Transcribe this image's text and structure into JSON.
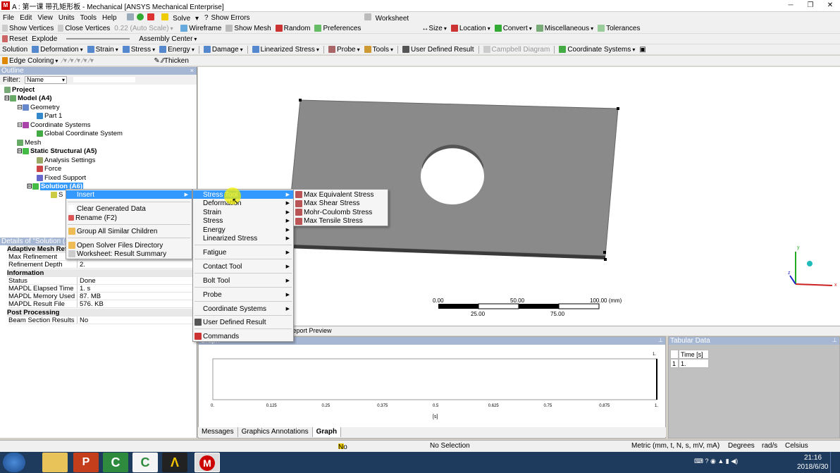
{
  "window": {
    "title": "A : 第一课 带孔矩形板 - Mechanical [ANSYS Mechanical Enterprise]"
  },
  "menubar": [
    "File",
    "Edit",
    "View",
    "Units",
    "Tools",
    "Help"
  ],
  "toolbar1": {
    "solve": "Solve",
    "show_errors": "Show Errors",
    "worksheet": "Worksheet"
  },
  "toolbar2": {
    "show_vertices": "Show Vertices",
    "close_vertices": "Close Vertices",
    "auto_scale": "0.22 (Auto Scale)",
    "wireframe": "Wireframe",
    "show_mesh": "Show Mesh",
    "random": "Random",
    "preferences": "Preferences",
    "size": "Size",
    "location": "Location",
    "convert": "Convert",
    "misc": "Miscellaneous",
    "tolerances": "Tolerances"
  },
  "toolbar3": {
    "reset": "Reset",
    "explode": "Explode",
    "assembly_center": "Assembly Center"
  },
  "toolbar4": {
    "solution": "Solution",
    "deformation": "Deformation",
    "strain": "Strain",
    "stress": "Stress",
    "energy": "Energy",
    "damage": "Damage",
    "linearized_stress": "Linearized Stress",
    "probe": "Probe",
    "tools": "Tools",
    "user_defined_result": "User Defined Result",
    "campbell": "Campbell Diagram",
    "coordinate_systems": "Coordinate Systems"
  },
  "toolbar5": {
    "edge_coloring": "Edge Coloring",
    "thicken": "Thicken"
  },
  "outline": {
    "header": "Outline",
    "filter_label": "Filter:",
    "filter_value": "Name",
    "nodes": {
      "project": "Project",
      "model": "Model (A4)",
      "geometry": "Geometry",
      "part1": "Part 1",
      "coord_systems": "Coordinate Systems",
      "global_cs": "Global Coordinate System",
      "mesh": "Mesh",
      "static": "Static Structural (A5)",
      "analysis_settings": "Analysis Settings",
      "force": "Force",
      "fixed_support": "Fixed Support",
      "solution": "Solution (A6)",
      "solution_info": "S"
    }
  },
  "details": {
    "header": "Details of \"Solution (A6)\"",
    "rows": [
      {
        "k": "Adaptive Mesh Refinement",
        "group": true
      },
      {
        "k": "Max Refinement Loops",
        "v": "1."
      },
      {
        "k": "Refinement Depth",
        "v": "2."
      },
      {
        "k": "Information",
        "group": true
      },
      {
        "k": "Status",
        "v": "Done"
      },
      {
        "k": "MAPDL Elapsed Time",
        "v": "1. s"
      },
      {
        "k": "MAPDL Memory Used",
        "v": "87. MB"
      },
      {
        "k": "MAPDL Result File Size",
        "v": "576. KB"
      },
      {
        "k": "Post Processing",
        "group": true
      },
      {
        "k": "Beam Section Results",
        "v": "No"
      }
    ]
  },
  "context_menu": {
    "insert": "Insert",
    "clear": "Clear Generated Data",
    "rename": "Rename (F2)",
    "group": "Group All Similar Children",
    "open_solver": "Open Solver Files Directory",
    "worksheet_summary": "Worksheet: Result Summary"
  },
  "insert_menu": [
    "Stress Tool",
    "Deformation",
    "Strain",
    "Stress",
    "Energy",
    "Linearized Stress",
    "Fatigue",
    "Contact Tool",
    "Bolt Tool",
    "Probe",
    "Coordinate Systems",
    "User Defined Result",
    "Commands"
  ],
  "stress_tool_menu": [
    "Max Equivalent Stress",
    "Max Shear Stress",
    "Mohr-Coulomb Stress",
    "Max Tensile Stress"
  ],
  "scale": {
    "t0": "0.00",
    "t50": "50.00",
    "t100": "100.00 (mm)",
    "t25": "25.00",
    "t75": "75.00"
  },
  "viewport_tab": "Report Preview",
  "graph": {
    "header": "Graph",
    "xticks": [
      "0.",
      "0.125",
      "0.25",
      "0.375",
      "0.5",
      "0.625",
      "0.75",
      "0.875",
      "1."
    ],
    "y_top": "1.",
    "xlabel": "[s]"
  },
  "tabular": {
    "header": "Tabular Data",
    "col": "Time [s]",
    "row_idx": "1",
    "row_val": "1."
  },
  "bottom_tabs": [
    "Messages",
    "Graphics Annotations",
    "Graph"
  ],
  "status": {
    "messages": "No Messages",
    "selection": "No Selection",
    "units": "Metric (mm, t, N, s, mV, mA)",
    "degrees": "Degrees",
    "rads": "rad/s",
    "celsius": "Celsius"
  },
  "clock": {
    "time": "21:16",
    "date": "2018/6/30"
  }
}
